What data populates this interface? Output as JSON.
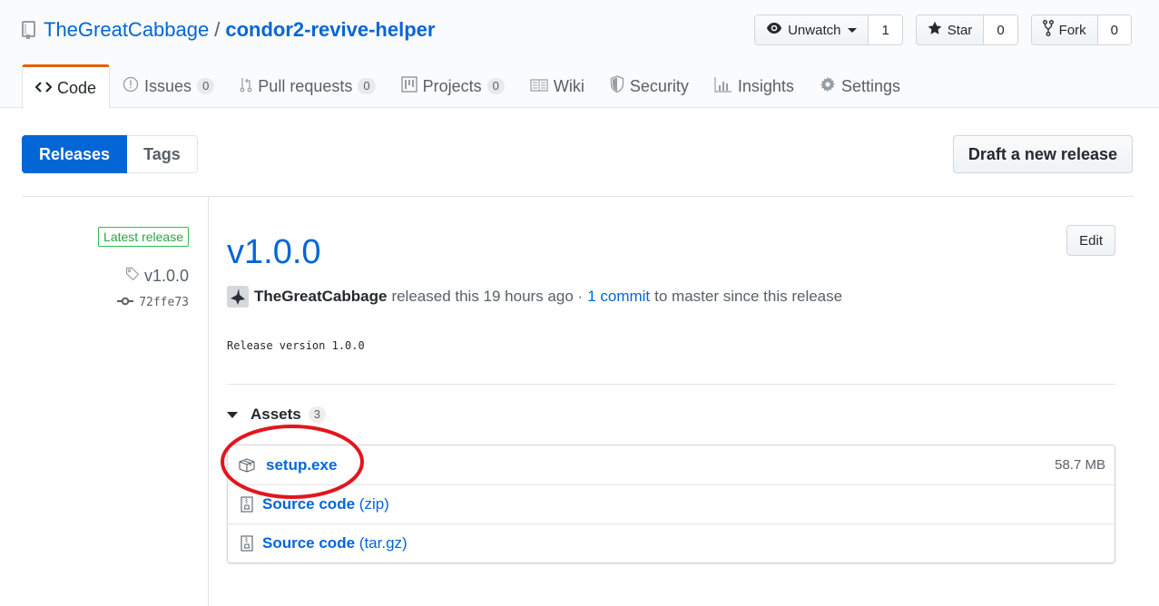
{
  "repo": {
    "owner": "TheGreatCabbage",
    "separator": "/",
    "name": "condor2-revive-helper",
    "icon": "repo-book-icon"
  },
  "actions": {
    "watch": {
      "label": "Unwatch",
      "count": "1",
      "icon": "eye-icon"
    },
    "star": {
      "label": "Star",
      "count": "0",
      "icon": "star-icon"
    },
    "fork": {
      "label": "Fork",
      "count": "0",
      "icon": "fork-icon"
    }
  },
  "nav": {
    "items": [
      {
        "label": "Code",
        "icon": "code-icon",
        "selected": true
      },
      {
        "label": "Issues",
        "count": "0",
        "icon": "issue-icon"
      },
      {
        "label": "Pull requests",
        "count": "0",
        "icon": "pull-request-icon"
      },
      {
        "label": "Projects",
        "count": "0",
        "icon": "project-icon"
      },
      {
        "label": "Wiki",
        "icon": "book-icon"
      },
      {
        "label": "Security",
        "icon": "shield-icon"
      },
      {
        "label": "Insights",
        "icon": "graph-icon"
      },
      {
        "label": "Settings",
        "icon": "gear-icon"
      }
    ]
  },
  "subnav": {
    "releases": "Releases",
    "tags": "Tags",
    "draft_button": "Draft a new release"
  },
  "release": {
    "latest_label": "Latest release",
    "tag": "v1.0.0",
    "commit_sha": "72ffe73",
    "title": "v1.0.0",
    "edit_label": "Edit",
    "author": "TheGreatCabbage",
    "released_text": "released this 19 hours ago ·",
    "commits_link": "1 commit",
    "commits_suffix": "to master since this release",
    "body": "Release version 1.0.0"
  },
  "assets": {
    "label": "Assets",
    "count": "3",
    "items": [
      {
        "name": "setup.exe",
        "ext": "",
        "size": "58.7 MB",
        "icon": "package-icon"
      },
      {
        "name": "Source code",
        "ext": "(zip)",
        "size": "",
        "icon": "file-zip-icon"
      },
      {
        "name": "Source code",
        "ext": "(tar.gz)",
        "size": "",
        "icon": "file-zip-icon"
      }
    ]
  },
  "annotation": {
    "color": "#e3151d",
    "target": "setup.exe"
  }
}
